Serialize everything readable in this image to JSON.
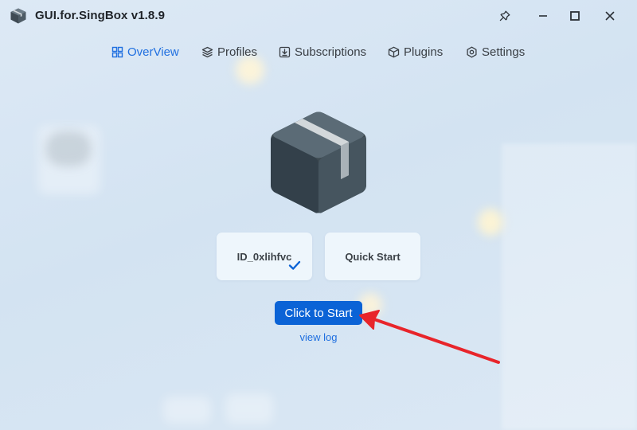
{
  "window": {
    "title": "GUI.for.SingBox v1.8.9",
    "controls": [
      "pin-icon",
      "minimize-icon",
      "maximize-icon",
      "close-icon"
    ]
  },
  "nav": {
    "items": [
      {
        "label": "OverView",
        "icon": "overview-icon",
        "active": true
      },
      {
        "label": "Profiles",
        "icon": "layers-icon",
        "active": false
      },
      {
        "label": "Subscriptions",
        "icon": "subscription-icon",
        "active": false
      },
      {
        "label": "Plugins",
        "icon": "cube-icon",
        "active": false
      },
      {
        "label": "Settings",
        "icon": "gear-icon",
        "active": false
      }
    ]
  },
  "main": {
    "logo_icon": "box-icon",
    "profile_card": {
      "label": "ID_0xlihfvc",
      "selected": true
    },
    "quick_start_card": {
      "label": "Quick Start"
    },
    "start_button": "Click to Start",
    "view_log": "view log"
  },
  "colors": {
    "accent": "#1f6fe0",
    "primary_button": "#0b63d6",
    "annotation_arrow": "#e8252b",
    "text": "#1f2328"
  }
}
